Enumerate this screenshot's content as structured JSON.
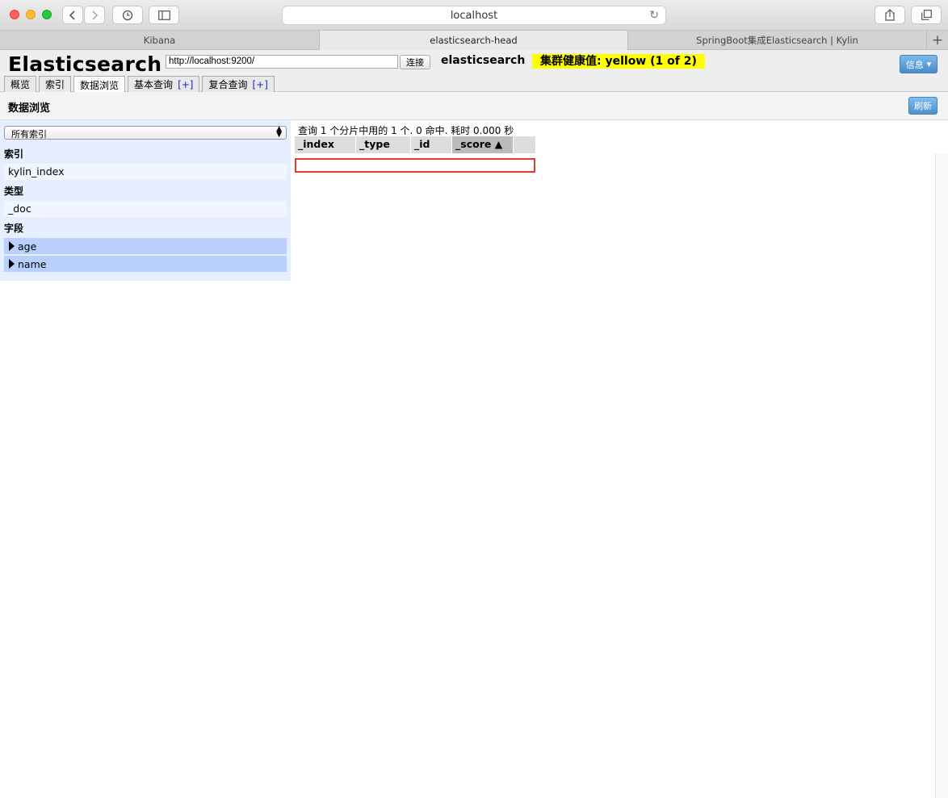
{
  "browser": {
    "address": "localhost",
    "tabs": [
      {
        "label": "Kibana",
        "active": false
      },
      {
        "label": "elasticsearch-head",
        "active": true
      },
      {
        "label": "SpringBoot集成Elasticsearch | Kylin",
        "active": false
      }
    ]
  },
  "header": {
    "brand": "Elasticsearch",
    "url_value": "http://localhost:9200/",
    "connect_label": "连接",
    "cluster_name": "elasticsearch",
    "health": "集群健康值: yellow (1 of 2)",
    "info_label": "信息",
    "nav": {
      "overview": "概览",
      "indices": "索引",
      "browser": "数据浏览",
      "basic_query": "基本查询",
      "complex_query": "复合查询",
      "plus": "[+]"
    }
  },
  "section": {
    "title": "数据浏览",
    "refresh_label": "刷新"
  },
  "left": {
    "index_select": "所有索引",
    "index_label": "索引",
    "index_value": "kylin_index",
    "type_label": "类型",
    "type_value": "_doc",
    "fields_label": "字段",
    "fields": [
      "age",
      "name"
    ]
  },
  "results": {
    "summary": "查询 1 个分片中用的 1 个. 0 命中. 耗时 0.000 秒",
    "columns": [
      "_index",
      "_type",
      "_id",
      "_score ▲"
    ]
  },
  "colors": {
    "health_yellow": "#ffff00",
    "button_blue": "#4a8dcb",
    "panel_bg": "#e5efff",
    "field_bg": "#b9d0ff",
    "error_border": "#d9402b"
  }
}
